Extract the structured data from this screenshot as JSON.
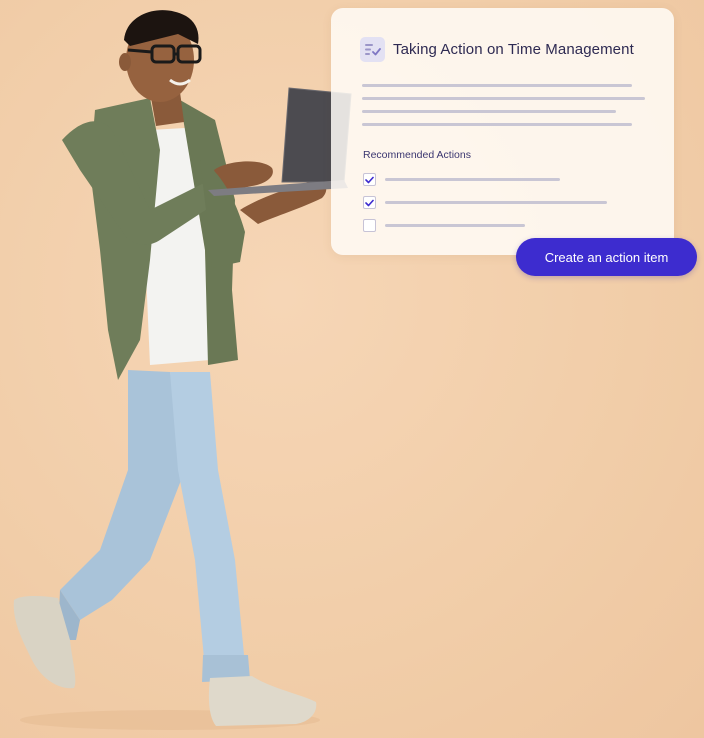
{
  "card": {
    "title": "Taking Action on Time Management",
    "icon": "checklist-icon",
    "recommended_label": "Recommended Actions",
    "actions": [
      {
        "checked": true
      },
      {
        "checked": true
      },
      {
        "checked": false
      }
    ]
  },
  "button": {
    "label": "Create an action item"
  },
  "colors": {
    "background": "#f2cfaa",
    "accent": "#3d2ccf",
    "title_text": "#2e2a52"
  }
}
